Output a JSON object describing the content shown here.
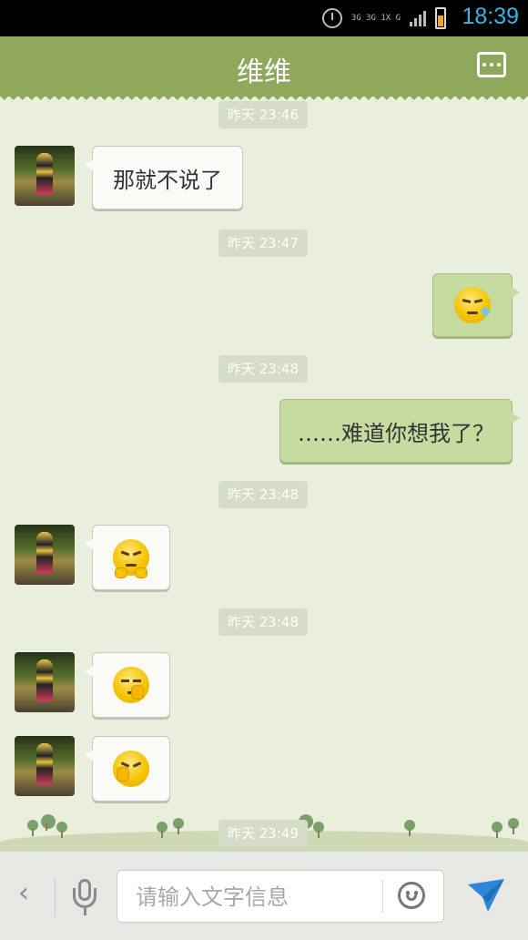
{
  "status_bar": {
    "network": "3G 3G 1X G",
    "time": "18:39"
  },
  "header": {
    "title": "维维"
  },
  "messages": [
    {
      "side": "left",
      "time": "昨天 23:46",
      "text": "那就不说了"
    },
    {
      "side": "right",
      "time": "昨天 23:47",
      "emoji": "sweat-face-emoji"
    },
    {
      "side": "right",
      "time": "昨天 23:48",
      "text": "……难道你想我了？"
    },
    {
      "side": "left",
      "time": "昨天 23:48",
      "emoji": "grumpy-face-emoji"
    },
    {
      "side": "left",
      "time": "昨天 23:48",
      "emoji": "hush-face-emoji"
    },
    {
      "side": "left",
      "emoji": "finger-face-emoji"
    },
    {
      "time": "昨天 23:49"
    }
  ],
  "input": {
    "placeholder": "请输入文字信息"
  },
  "colors": {
    "header": "#8fa85b",
    "background": "#e9efdc",
    "sent_bubble": "#c5dba0",
    "received_bubble": "#fafaf7",
    "clock": "#33b5e5"
  }
}
